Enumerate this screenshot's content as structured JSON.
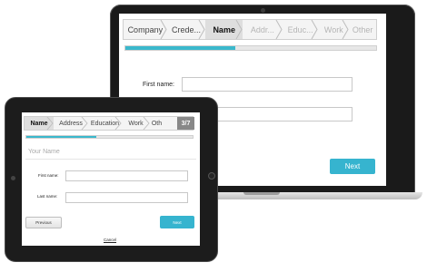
{
  "laptop": {
    "steps": [
      {
        "label": "Company",
        "state": "done"
      },
      {
        "label": "Crede...",
        "state": "done"
      },
      {
        "label": "Name",
        "state": "active"
      },
      {
        "label": "Addr...",
        "state": "disabled"
      },
      {
        "label": "Educ...",
        "state": "disabled"
      },
      {
        "label": "Work",
        "state": "disabled"
      },
      {
        "label": "Other",
        "state": "disabled"
      }
    ],
    "progress": 0.44,
    "first_name_label": "First name:",
    "next_label": "Next"
  },
  "tablet": {
    "steps": [
      {
        "label": "Name",
        "state": "active"
      },
      {
        "label": "Address",
        "state": "normal"
      },
      {
        "label": "Education",
        "state": "normal"
      },
      {
        "label": "Work",
        "state": "normal"
      },
      {
        "label": "Oth",
        "state": "normal"
      }
    ],
    "step_counter": "3/7",
    "progress": 0.42,
    "section_title": "Your Name",
    "first_name_label": "First name:",
    "last_name_label": "Last name:",
    "previous_label": "Previous",
    "next_label": "Next",
    "cancel_label": "Cancel"
  },
  "colors": {
    "accent": "#36b4cf",
    "device_frame": "#1c1c1c"
  }
}
